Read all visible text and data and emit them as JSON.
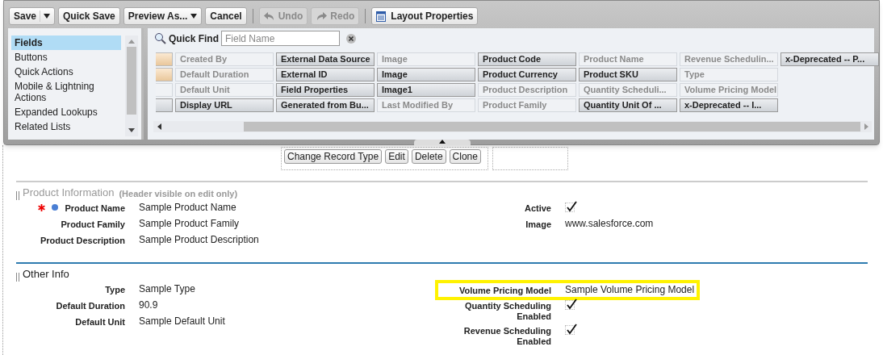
{
  "toolbar": [
    {
      "label": "Save",
      "kind": "split",
      "disabled": false
    },
    {
      "label": "Quick Save",
      "kind": "plain",
      "disabled": false
    },
    {
      "label": "Preview As...",
      "kind": "menu",
      "disabled": false
    },
    {
      "label": "Cancel",
      "kind": "plain",
      "disabled": false
    },
    {
      "label": "Undo",
      "kind": "undo",
      "disabled": true
    },
    {
      "label": "Redo",
      "kind": "redo",
      "disabled": true
    },
    {
      "label": "Layout Properties",
      "kind": "properties",
      "disabled": false
    }
  ],
  "palette_categories": [
    {
      "label": "Fields",
      "selected": true
    },
    {
      "label": "Buttons",
      "selected": false
    },
    {
      "label": "Quick Actions",
      "selected": false
    },
    {
      "label": "Mobile & Lightning Actions",
      "selected": false
    },
    {
      "label": "Expanded Lookups",
      "selected": false
    },
    {
      "label": "Related Lists",
      "selected": false
    }
  ],
  "quick_find": {
    "label": "Quick Find",
    "placeholder": "Field Name"
  },
  "leading_tiles": [
    {
      "kind": "blank"
    },
    {
      "kind": "blank"
    },
    {
      "kind": "plain"
    },
    {
      "kind": "button"
    }
  ],
  "field_tiles": [
    [
      {
        "label": "Created By",
        "used": true
      },
      {
        "label": "Default Duration",
        "used": true
      },
      {
        "label": "Default Unit",
        "used": true
      },
      {
        "label": "Display URL",
        "used": false
      }
    ],
    [
      {
        "label": "External Data Source",
        "used": false
      },
      {
        "label": "External ID",
        "used": false
      },
      {
        "label": "Field Properties",
        "used": false
      },
      {
        "label": "Generated from Bu...",
        "used": false
      }
    ],
    [
      {
        "label": "Image",
        "used": true
      },
      {
        "label": "Image",
        "used": false
      },
      {
        "label": "Image1",
        "used": false
      },
      {
        "label": "Last Modified By",
        "used": true
      }
    ],
    [
      {
        "label": "Product Code",
        "used": false
      },
      {
        "label": "Product Currency",
        "used": false
      },
      {
        "label": "Product Description",
        "used": true
      },
      {
        "label": "Product Family",
        "used": true
      }
    ],
    [
      {
        "label": "Product Name",
        "used": true
      },
      {
        "label": "Product SKU",
        "used": false
      },
      {
        "label": "Quantity Scheduli...",
        "used": true
      },
      {
        "label": "Quantity Unit Of ...",
        "used": false
      }
    ],
    [
      {
        "label": "Revenue Schedulin...",
        "used": true
      },
      {
        "label": "Type",
        "used": true
      },
      {
        "label": "Volume Pricing Model",
        "used": true
      },
      {
        "label": "x-Deprecated -- I...",
        "used": false
      }
    ],
    [
      {
        "label": "x-Deprecated -- P...",
        "used": false
      }
    ]
  ],
  "detail_buttons": [
    "Change Record Type",
    "Edit",
    "Delete",
    "Clone"
  ],
  "sections": [
    {
      "title": "Product Information",
      "note": "(Header visible on edit only)",
      "header_visible": false,
      "left": [
        {
          "label": "Product Name",
          "kind": "text",
          "value": "Sample Product Name",
          "required": true,
          "indicator": true,
          "highlighted": false
        },
        {
          "label": "Product Family",
          "kind": "text",
          "value": "Sample Product Family",
          "required": false,
          "indicator": false,
          "highlighted": false
        },
        {
          "label": "Product Description",
          "kind": "text",
          "value": "Sample Product Description",
          "required": false,
          "indicator": false,
          "highlighted": false
        }
      ],
      "right": [
        {
          "label": "Active",
          "kind": "checkbox",
          "checked": true,
          "required": false,
          "indicator": false,
          "highlighted": false
        },
        {
          "label": "Image",
          "kind": "text",
          "value": "www.salesforce.com",
          "required": false,
          "indicator": false,
          "highlighted": false
        }
      ]
    },
    {
      "title": "Other Info",
      "header_visible": true,
      "left": [
        {
          "label": "Type",
          "kind": "text",
          "value": "Sample Type",
          "required": false,
          "indicator": false,
          "highlighted": false
        },
        {
          "label": "Default Duration",
          "kind": "text",
          "value": "90.9",
          "required": false,
          "indicator": false,
          "highlighted": false
        },
        {
          "label": "Default Unit",
          "kind": "text",
          "value": "Sample Default Unit",
          "required": false,
          "indicator": false,
          "highlighted": false
        }
      ],
      "right": [
        {
          "label": "Volume Pricing Model",
          "kind": "text",
          "value": "Sample Volume Pricing Model",
          "required": false,
          "indicator": false,
          "highlighted": true
        },
        {
          "label": "Quantity Scheduling Enabled",
          "kind": "checkbox",
          "checked": true,
          "required": false,
          "indicator": false,
          "highlighted": false
        },
        {
          "label": "Revenue Scheduling Enabled",
          "kind": "checkbox",
          "checked": true,
          "required": false,
          "indicator": false,
          "highlighted": false
        }
      ]
    }
  ]
}
